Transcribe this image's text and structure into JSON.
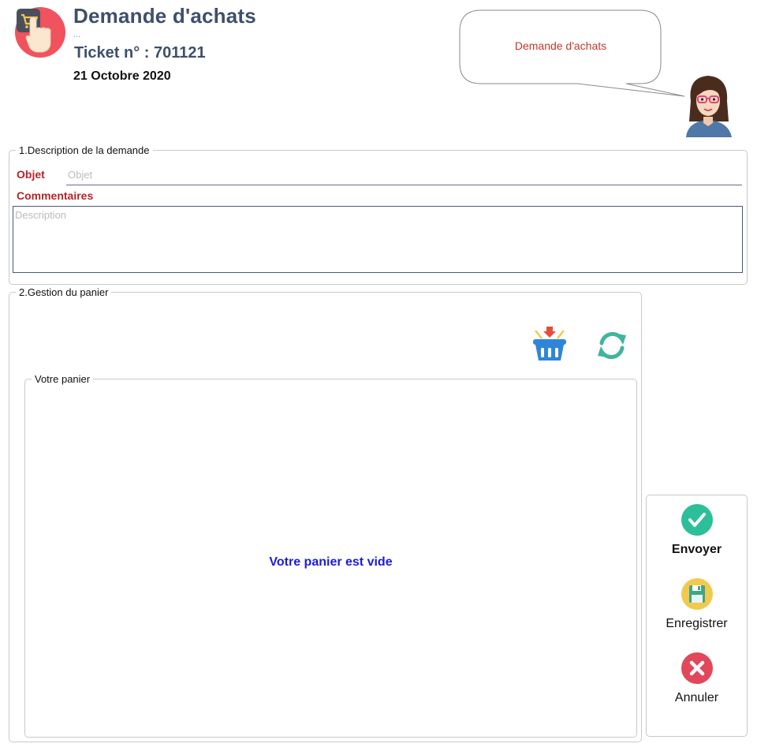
{
  "header": {
    "title": "Demande d'achats",
    "subtitle": "...",
    "ticket": "Ticket n° : 701121",
    "date": "21 Octobre 2020",
    "logo_icon": "shopping-cart-touch-icon",
    "bubble_text": "Demande d'achats",
    "avatar_icon": "assistant-avatar-icon"
  },
  "description_section": {
    "legend": "1.Description de la demande",
    "objet_label": "Objet",
    "objet_placeholder": "Objet",
    "objet_value": "",
    "comments_label": "Commentaires",
    "comments_placeholder": "Description",
    "comments_value": ""
  },
  "cart_section": {
    "legend": "2.Gestion du panier",
    "add_to_basket_icon": "basket-add-icon",
    "refresh_icon": "refresh-icon",
    "cart_legend": "Votre panier",
    "empty_message": "Votre panier est vide"
  },
  "actions": {
    "send_label": "Envoyer",
    "save_label": "Enregistrer",
    "cancel_label": "Annuler"
  },
  "colors": {
    "title": "#3f4f6b",
    "label_red": "#b0262a",
    "empty_message": "#1c1cd6",
    "send_green": "#2cbf9a",
    "save_yellow": "#f2c94c",
    "cancel_red": "#e2475a",
    "basket_blue": "#2f86d8"
  }
}
